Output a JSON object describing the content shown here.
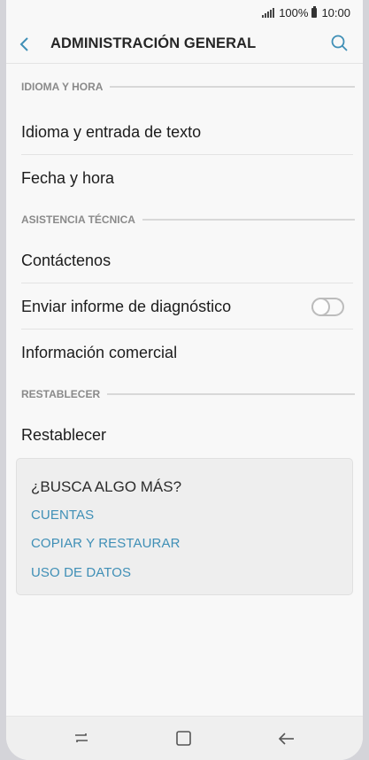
{
  "status_bar": {
    "battery": "100%",
    "time": "10:00"
  },
  "header": {
    "title": "ADMINISTRACIÓN GENERAL"
  },
  "sections": [
    {
      "header": "IDIOMA Y HORA",
      "items": [
        "Idioma y entrada de texto",
        "Fecha y hora"
      ]
    },
    {
      "header": "ASISTENCIA TÉCNICA",
      "items": [
        "Contáctenos",
        "Enviar informe de diagnóstico",
        "Información comercial"
      ]
    },
    {
      "header": "RESTABLECER",
      "items": [
        "Restablecer"
      ]
    }
  ],
  "diagnostic_toggle": {
    "on": false
  },
  "card": {
    "title": "¿BUSCA ALGO MÁS?",
    "links": [
      "CUENTAS",
      "COPIAR Y RESTAURAR",
      "USO DE DATOS"
    ]
  },
  "colors": {
    "accent": "#3f8fb6",
    "section_header": "#8a8a8a",
    "background": "#f8f8f8"
  },
  "icons": {
    "back": "back-arrow-icon",
    "search": "search-icon",
    "recents": "recent-apps-icon",
    "home": "home-icon",
    "nav_back": "back-icon"
  }
}
